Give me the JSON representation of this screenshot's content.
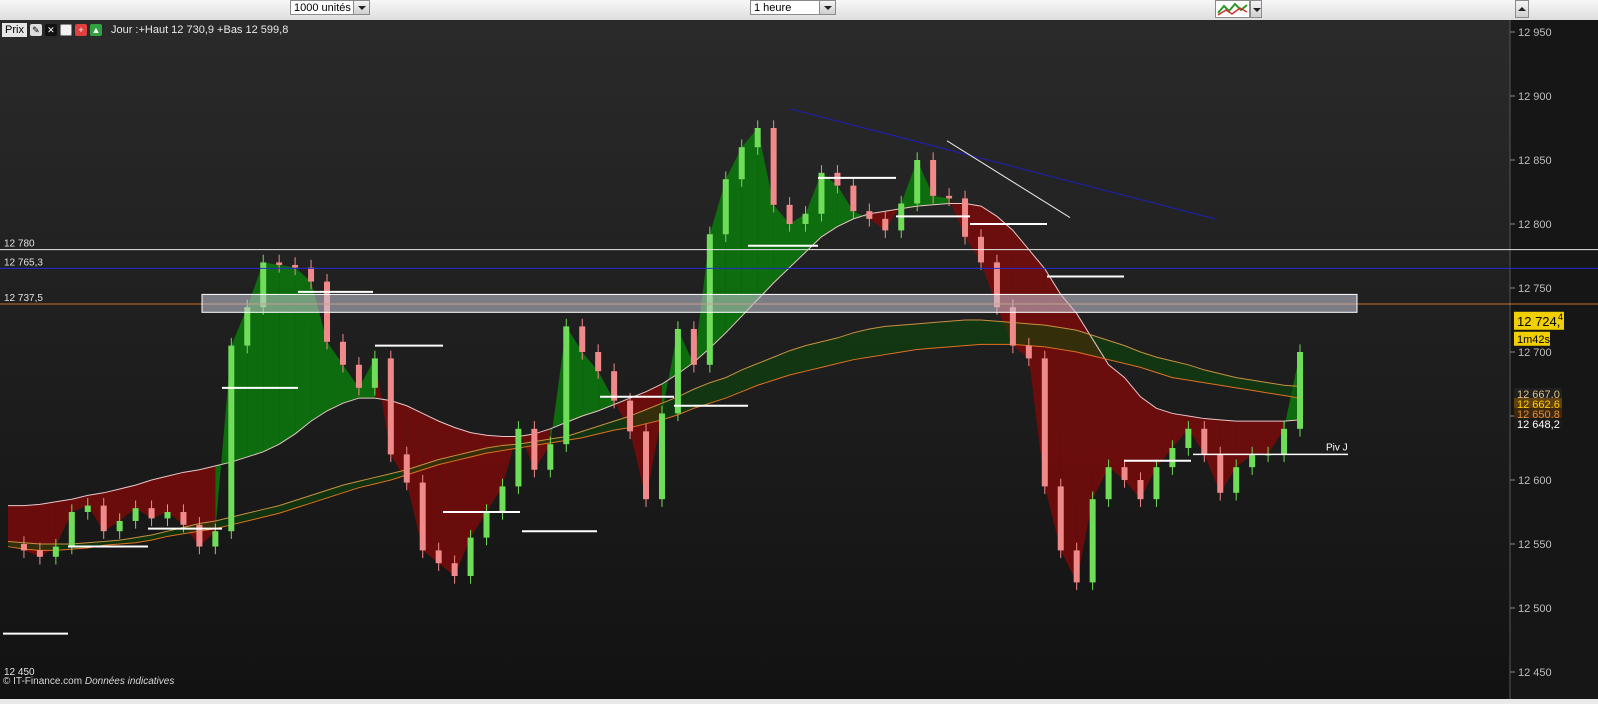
{
  "toolbar": {
    "units_select": "1000 unités",
    "interval_select": "1 heure",
    "price_tab_label": "Prix",
    "info_text": "Jour :+Haut 12 730,9 +Bas 12 599,8"
  },
  "footer": {
    "source": "© IT-Finance.com",
    "note": "Données indicatives"
  },
  "colors": {
    "background": "#1e1e1e",
    "bull_fill": "#0b7a0b",
    "bear_fill": "#7a0b0b",
    "candle_up": "#6fdc5a",
    "candle_down": "#f08a8a",
    "trendline_blue": "#1e1ebe",
    "trendline_white": "#e8e8e8",
    "current_price_box": "#f0d000"
  },
  "chart_data": {
    "type": "line",
    "title": "",
    "xlabel": "",
    "ylabel": "",
    "ylim": [
      12450,
      12950
    ],
    "yticks": [
      "12 950",
      "12 900",
      "12 850",
      "12 800",
      "12 750",
      "12 700",
      "12 650",
      "12 600",
      "12 550",
      "12 500",
      "12 450"
    ],
    "x": [
      1,
      2,
      3,
      4,
      5,
      6,
      7,
      8,
      9,
      10,
      11,
      12,
      13,
      14,
      15,
      16,
      17,
      18,
      19,
      20,
      21,
      22,
      23,
      24,
      25,
      26,
      27,
      28,
      29,
      30,
      31,
      32,
      33,
      34,
      35,
      36,
      37,
      38,
      39,
      40,
      41,
      42,
      43,
      44,
      45,
      46,
      47,
      48,
      49,
      50,
      51,
      52,
      53,
      54,
      55,
      56,
      57,
      58,
      59,
      60,
      61,
      62,
      63,
      64,
      65,
      66,
      67,
      68,
      69,
      70,
      71,
      72,
      73,
      74,
      75,
      76,
      77,
      78,
      79,
      80,
      81,
      82
    ],
    "series": [
      {
        "values": [
          12550,
          12545,
          12540,
          12548,
          12575,
          12580,
          12560,
          12568,
          12578,
          12570,
          12575,
          12565,
          12548,
          12560,
          12705,
          12735,
          12770,
          12768,
          12766,
          12755,
          12708,
          12690,
          12672,
          12695,
          12620,
          12598,
          12545,
          12535,
          12525,
          12555,
          12575,
          12595,
          12640,
          12608,
          12628,
          12720,
          12700,
          12685,
          12662,
          12638,
          12585,
          12652,
          12718,
          12690,
          12792,
          12835,
          12860,
          12875,
          12815,
          12800,
          12808,
          12840,
          12830,
          12810,
          12804,
          12795,
          12816,
          12850,
          12822,
          12820,
          12790,
          12770,
          12735,
          12705,
          12695,
          12595,
          12545,
          12520,
          12585,
          12610,
          12600,
          12585,
          12610,
          12625,
          12640,
          12620,
          12590,
          12610,
          12620,
          12620,
          12640,
          12700
        ]
      },
      {
        "values": [
          12580,
          12580,
          12581,
          12583,
          12585,
          12588,
          12590,
          12593,
          12596,
          12600,
          12603,
          12606,
          12608,
          12611,
          12614,
          12618,
          12622,
          12628,
          12636,
          12646,
          12654,
          12660,
          12664,
          12664,
          12662,
          12658,
          12652,
          12646,
          12641,
          12637,
          12635,
          12634,
          12634,
          12636,
          12640,
          12645,
          12650,
          12654,
          12659,
          12664,
          12669,
          12675,
          12683,
          12692,
          12703,
          12715,
          12728,
          12741,
          12754,
          12766,
          12778,
          12790,
          12798,
          12804,
          12808,
          12810,
          12812,
          12814,
          12815,
          12816,
          12816,
          12814,
          12806,
          12795,
          12780,
          12765,
          12745,
          12730,
          12710,
          12690,
          12680,
          12665,
          12656,
          12652,
          12650,
          12648,
          12647,
          12646,
          12646,
          12646,
          12646,
          12647
        ]
      },
      {
        "values": [
          12552,
          12551,
          12550,
          12550,
          12550,
          12551,
          12552,
          12553,
          12555,
          12557,
          12560,
          12563,
          12566,
          12568,
          12571,
          12574,
          12577,
          12580,
          12584,
          12588,
          12592,
          12596,
          12599,
          12602,
          12605,
          12608,
          12612,
          12616,
          12619,
          12622,
          12625,
          12627,
          12628,
          12630,
          12632,
          12634,
          12638,
          12642,
          12646,
          12650,
          12655,
          12660,
          12665,
          12671,
          12676,
          12680,
          12686,
          12691,
          12696,
          12701,
          12705,
          12708,
          12711,
          12715,
          12718,
          12720,
          12721,
          12722,
          12723,
          12724,
          12725,
          12725,
          12724,
          12723,
          12722,
          12721,
          12719,
          12717,
          12713,
          12709,
          12705,
          12700,
          12696,
          12693,
          12690,
          12686,
          12683,
          12680,
          12678,
          12676,
          12674,
          12673
        ]
      },
      {
        "values": [
          12548,
          12546,
          12545,
          12545,
          12546,
          12547,
          12549,
          12550,
          12551,
          12553,
          12556,
          12558,
          12560,
          12562,
          12565,
          12568,
          12571,
          12574,
          12578,
          12582,
          12586,
          12590,
          12594,
          12597,
          12600,
          12604,
          12608,
          12612,
          12615,
          12618,
          12621,
          12623,
          12625,
          12627,
          12629,
          12631,
          12633,
          12636,
          12639,
          12641,
          12644,
          12647,
          12651,
          12656,
          12660,
          12664,
          12669,
          12674,
          12678,
          12682,
          12685,
          12688,
          12691,
          12694,
          12696,
          12698,
          12700,
          12702,
          12703,
          12704,
          12705,
          12706,
          12706,
          12706,
          12705,
          12704,
          12702,
          12700,
          12697,
          12694,
          12691,
          12688,
          12684,
          12680,
          12678,
          12676,
          12674,
          12672,
          12670,
          12668,
          12666,
          12664
        ]
      }
    ],
    "hlines": [
      {
        "label": "12 780",
        "value": 12780
      },
      {
        "label": "12 765,3",
        "value": 12765.3
      },
      {
        "label": "12 737,5",
        "value": 12737.5
      }
    ],
    "zone": {
      "from": 12731,
      "to": 12745
    },
    "pivot_label": "Piv J",
    "last_price": {
      "label": "12 724,",
      "sup": "4",
      "countdown": "1m42s"
    },
    "right_labels": [
      "12 667,0",
      "12 662,6",
      "12 650,8",
      "12 648,2"
    ],
    "bottom_left_label": "12 450",
    "grid": false,
    "legend": "none"
  }
}
